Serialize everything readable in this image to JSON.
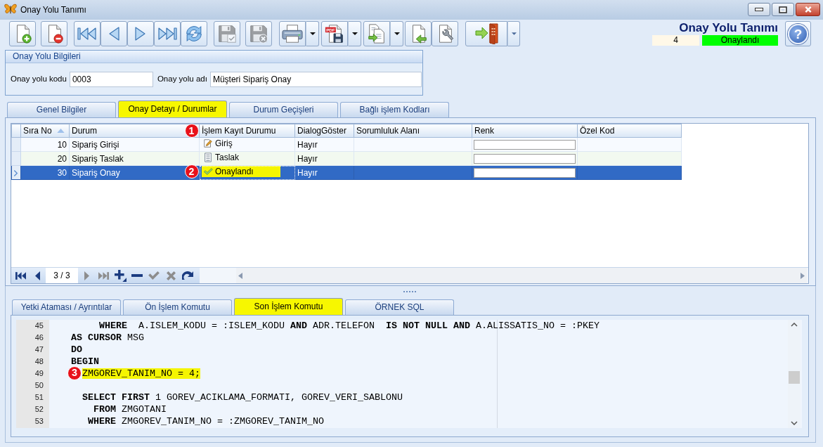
{
  "window": {
    "title": "Onay Yolu Tanımı",
    "controls": [
      {
        "kind": "minimize"
      },
      {
        "kind": "maximize"
      },
      {
        "kind": "close"
      }
    ]
  },
  "toolbar": [
    {
      "kind": "new",
      "disabled": false,
      "dropdown": false
    },
    {
      "kind": "delete",
      "disabled": false,
      "dropdown": false
    },
    {
      "kind": "first",
      "disabled": false,
      "dropdown": false
    },
    {
      "kind": "previous",
      "disabled": false,
      "dropdown": false
    },
    {
      "kind": "next",
      "disabled": false,
      "dropdown": false
    },
    {
      "kind": "last",
      "disabled": false,
      "dropdown": false
    },
    {
      "kind": "refresh",
      "disabled": false,
      "dropdown": false
    },
    {
      "kind": "save",
      "disabled": true,
      "dropdown": false
    },
    {
      "kind": "discard",
      "disabled": true,
      "dropdown": false
    },
    {
      "kind": "print",
      "disabled": false,
      "dropdown": true
    },
    {
      "kind": "pdf",
      "disabled": false,
      "dropdown": true,
      "label": "PDF"
    },
    {
      "kind": "copy",
      "disabled": false,
      "dropdown": true
    },
    {
      "kind": "import",
      "disabled": false,
      "dropdown": false
    },
    {
      "kind": "tools",
      "disabled": false,
      "dropdown": false
    },
    {
      "kind": "exit",
      "disabled": false,
      "dropdown": true
    }
  ],
  "header": {
    "title": "Onay Yolu Tanımı",
    "record_no": "4",
    "status": "Onaylandı",
    "help": "?"
  },
  "info_group": {
    "title": "Onay Yolu Bilgileri",
    "fields": [
      {
        "label": "Onay yolu kodu",
        "value": "0003"
      },
      {
        "label": "Onay yolu adı",
        "value": "Müşteri Sipariş Onay"
      }
    ]
  },
  "tabs": [
    {
      "label": "Genel Bilgiler",
      "selected": false
    },
    {
      "label": "Onay Detayı / Durumlar",
      "selected": true
    },
    {
      "label": "Durum Geçişleri",
      "selected": false
    },
    {
      "label": "Bağlı işlem Kodları",
      "selected": false
    }
  ],
  "grid": {
    "columns": [
      {
        "label": "Sıra No",
        "kind": "number",
        "sorted": true
      },
      {
        "label": "Durum",
        "kind": "text"
      },
      {
        "label": "İşlem Kayıt Durumu",
        "kind": "status",
        "marker": "1"
      },
      {
        "label": "DialogGöster",
        "kind": "text"
      },
      {
        "label": "Sorumluluk Alanı",
        "kind": "text"
      },
      {
        "label": "Renk",
        "kind": "color"
      },
      {
        "label": "Özel Kod",
        "kind": "text"
      }
    ],
    "rows": [
      {
        "sira_no": "10",
        "durum": "Sipariş Girişi",
        "kayit_durumu": {
          "kind": "entry",
          "text": "Giriş",
          "highlighted": false
        },
        "dialog_goster": "Hayır",
        "selected": false
      },
      {
        "sira_no": "20",
        "durum": "Sipariş Taslak",
        "kayit_durumu": {
          "kind": "draft",
          "text": "Taslak",
          "highlighted": false
        },
        "dialog_goster": "Hayır",
        "selected": false
      },
      {
        "sira_no": "30",
        "durum": "Sipariş Onay",
        "kayit_durumu": {
          "kind": "approved",
          "text": "Onaylandı",
          "highlighted": true,
          "marker": "2"
        },
        "dialog_goster": "Hayır",
        "selected": true
      }
    ]
  },
  "navigator": {
    "position": "3 / 3",
    "buttons": [
      {
        "kind": "first",
        "disabled": false
      },
      {
        "kind": "previous",
        "disabled": false
      },
      {
        "kind": "next",
        "disabled": true
      },
      {
        "kind": "last",
        "disabled": true
      },
      {
        "kind": "add",
        "disabled": false
      },
      {
        "kind": "remove",
        "disabled": false
      },
      {
        "kind": "confirm",
        "disabled": true
      },
      {
        "kind": "cancel",
        "disabled": true
      },
      {
        "kind": "refresh",
        "disabled": false
      }
    ]
  },
  "bottom_tabs": [
    {
      "label": "Yetki Ataması / Ayrıntılar",
      "selected": false
    },
    {
      "label": "Ön İşlem Komutu",
      "selected": false
    },
    {
      "label": "Son İşlem Komutu",
      "selected": true
    },
    {
      "label": "ÖRNEK SQL",
      "selected": false
    }
  ],
  "editor": {
    "lines": [
      {
        "number": "45",
        "text": "       **WHERE**  A.ISLEM_KODU = :ISLEM_KODU **AND** ADR.TELEFON  **IS NOT NULL AND** A.ALISSATIS_NO = :PKEY",
        "highlighted": false
      },
      {
        "number": "46",
        "text": "  **AS CURSOR** MSG",
        "highlighted": false
      },
      {
        "number": "47",
        "text": "  **DO**",
        "highlighted": false
      },
      {
        "number": "48",
        "text": "  **BEGIN**",
        "highlighted": false
      },
      {
        "number": "49",
        "text": "    ZMGOREV_TANIM_NO = 4;",
        "highlighted": true,
        "marker": "3"
      },
      {
        "number": "50"
      },
      {
        "number": "51",
        "text": "    **SELECT FIRST** 1 GOREV_ACIKLAMA_FORMATI, GOREV_VERI_SABLONU",
        "highlighted": false
      },
      {
        "number": "52",
        "text": "      **FROM** ZMGOTANI",
        "highlighted": false
      },
      {
        "number": "53",
        "text": "     **WHERE** ZMGOREV_TANIM_NO = :ZMGOREV_TANIM_NO",
        "highlighted": false
      }
    ]
  }
}
